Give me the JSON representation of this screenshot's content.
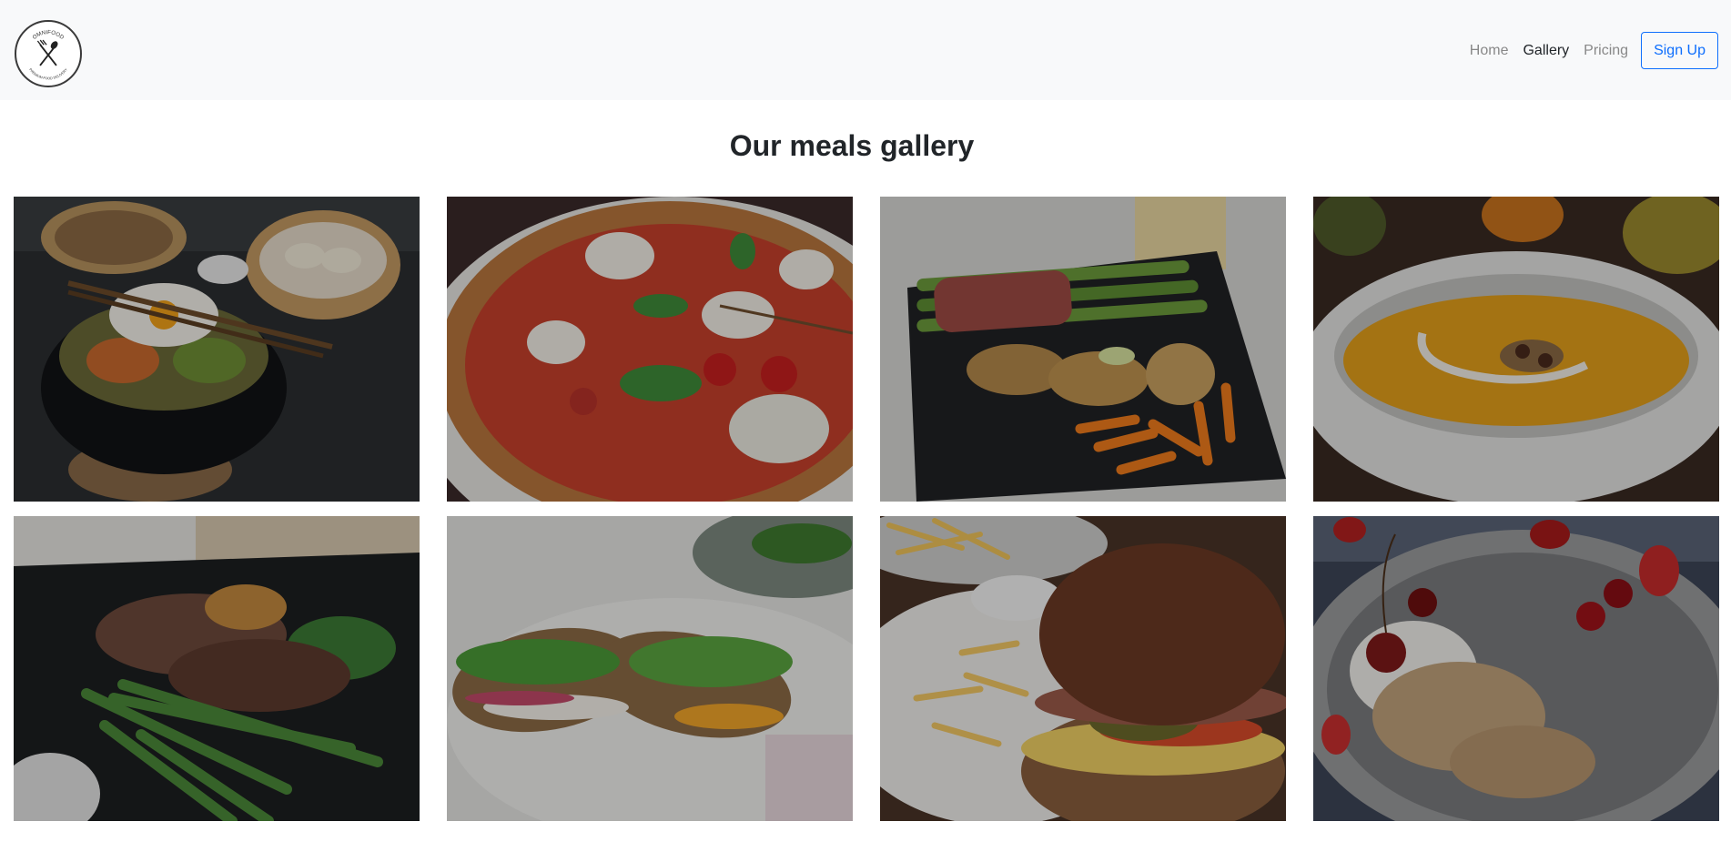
{
  "brand": {
    "logo_icon": "fork-and-spoon-logo-icon",
    "logo_text_top": "OMNIFOOD",
    "logo_text_bottom": "PREMIUM FOOD DELIVERY"
  },
  "nav": {
    "items": [
      {
        "label": "Home",
        "active": false
      },
      {
        "label": "Gallery",
        "active": true
      },
      {
        "label": "Pricing",
        "active": false
      }
    ],
    "signup_label": "Sign Up",
    "accent_color": "#0d6efd"
  },
  "gallery": {
    "title": "Our meals gallery",
    "overlay_color": "rgba(0,0,0,0.28)",
    "photos": [
      {
        "name": "bibimbap-photo"
      },
      {
        "name": "pizza-photo"
      },
      {
        "name": "chicken-asparagus-photo"
      },
      {
        "name": "pumpkin-soup-photo"
      },
      {
        "name": "steak-photo"
      },
      {
        "name": "sandwich-photo"
      },
      {
        "name": "burger-photo"
      },
      {
        "name": "yogurt-granola-photo"
      }
    ]
  }
}
